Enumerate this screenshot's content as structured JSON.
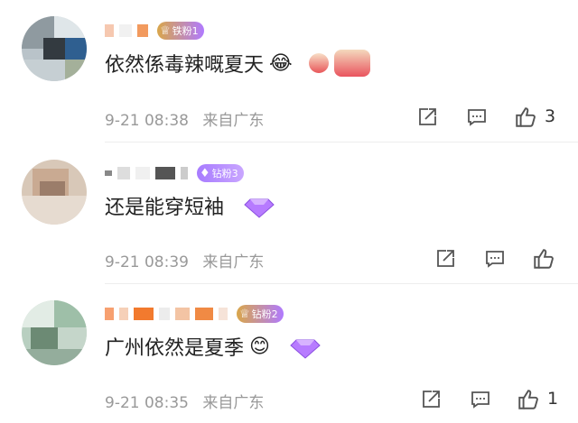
{
  "comments": [
    {
      "badge_label": "铁粉1",
      "badge_icon": "♕",
      "text": "依然係毒辣嘅夏天",
      "emoji": "😂",
      "time": "9-21 08:38",
      "location": "来自广东",
      "likes": "3"
    },
    {
      "badge_label": "钻粉3",
      "badge_icon": "♦",
      "text": "还是能穿短袖",
      "emoji": "",
      "time": "9-21 08:39",
      "location": "来自广东",
      "likes": ""
    },
    {
      "badge_label": "钻粉2",
      "badge_icon": "♕",
      "text": "广州依然是夏季",
      "emoji": "😊",
      "time": "9-21 08:35",
      "location": "来自广东",
      "likes": "1"
    }
  ],
  "colors": {
    "meta_text": "#999999",
    "badge_gold": "#d9a64a",
    "badge_purple": "#a77bff",
    "icon_stroke": "#555555"
  },
  "icons": [
    "share-icon",
    "comment-icon",
    "like-icon",
    "diamond-sticker-icon"
  ]
}
